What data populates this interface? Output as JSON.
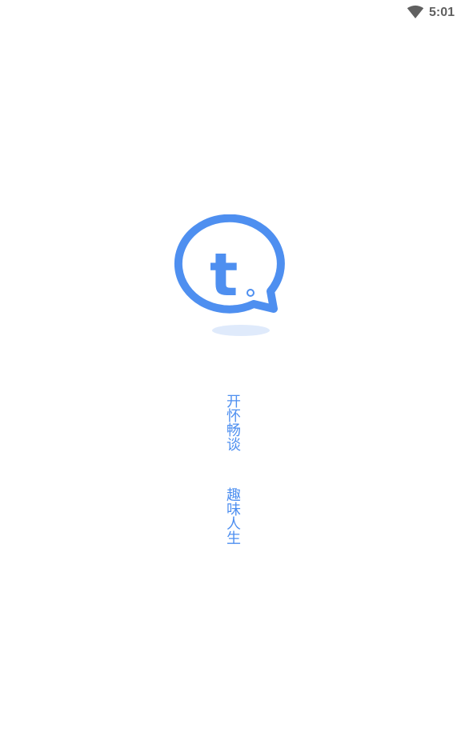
{
  "status_bar": {
    "time": "5:01",
    "wifi_icon": "wifi-icon"
  },
  "logo": {
    "letter": "t",
    "color": "#4e8ff0",
    "shadow_color": "#dfeafb"
  },
  "slogan": {
    "line1": "开怀畅谈",
    "line2": "趣味人生",
    "color": "#4e8ff0"
  }
}
